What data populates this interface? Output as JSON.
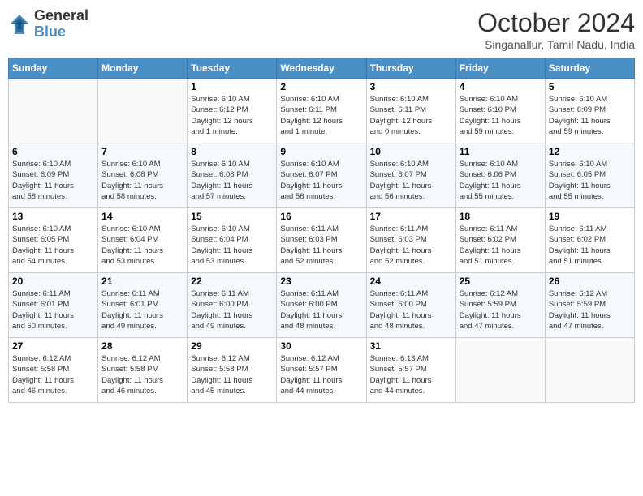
{
  "logo": {
    "line1": "General",
    "line2": "Blue"
  },
  "title": "October 2024",
  "location": "Singanallur, Tamil Nadu, India",
  "weekdays": [
    "Sunday",
    "Monday",
    "Tuesday",
    "Wednesday",
    "Thursday",
    "Friday",
    "Saturday"
  ],
  "weeks": [
    [
      {
        "day": "",
        "info": ""
      },
      {
        "day": "",
        "info": ""
      },
      {
        "day": "1",
        "info": "Sunrise: 6:10 AM\nSunset: 6:12 PM\nDaylight: 12 hours\nand 1 minute."
      },
      {
        "day": "2",
        "info": "Sunrise: 6:10 AM\nSunset: 6:11 PM\nDaylight: 12 hours\nand 1 minute."
      },
      {
        "day": "3",
        "info": "Sunrise: 6:10 AM\nSunset: 6:11 PM\nDaylight: 12 hours\nand 0 minutes."
      },
      {
        "day": "4",
        "info": "Sunrise: 6:10 AM\nSunset: 6:10 PM\nDaylight: 11 hours\nand 59 minutes."
      },
      {
        "day": "5",
        "info": "Sunrise: 6:10 AM\nSunset: 6:09 PM\nDaylight: 11 hours\nand 59 minutes."
      }
    ],
    [
      {
        "day": "6",
        "info": "Sunrise: 6:10 AM\nSunset: 6:09 PM\nDaylight: 11 hours\nand 58 minutes."
      },
      {
        "day": "7",
        "info": "Sunrise: 6:10 AM\nSunset: 6:08 PM\nDaylight: 11 hours\nand 58 minutes."
      },
      {
        "day": "8",
        "info": "Sunrise: 6:10 AM\nSunset: 6:08 PM\nDaylight: 11 hours\nand 57 minutes."
      },
      {
        "day": "9",
        "info": "Sunrise: 6:10 AM\nSunset: 6:07 PM\nDaylight: 11 hours\nand 56 minutes."
      },
      {
        "day": "10",
        "info": "Sunrise: 6:10 AM\nSunset: 6:07 PM\nDaylight: 11 hours\nand 56 minutes."
      },
      {
        "day": "11",
        "info": "Sunrise: 6:10 AM\nSunset: 6:06 PM\nDaylight: 11 hours\nand 55 minutes."
      },
      {
        "day": "12",
        "info": "Sunrise: 6:10 AM\nSunset: 6:05 PM\nDaylight: 11 hours\nand 55 minutes."
      }
    ],
    [
      {
        "day": "13",
        "info": "Sunrise: 6:10 AM\nSunset: 6:05 PM\nDaylight: 11 hours\nand 54 minutes."
      },
      {
        "day": "14",
        "info": "Sunrise: 6:10 AM\nSunset: 6:04 PM\nDaylight: 11 hours\nand 53 minutes."
      },
      {
        "day": "15",
        "info": "Sunrise: 6:10 AM\nSunset: 6:04 PM\nDaylight: 11 hours\nand 53 minutes."
      },
      {
        "day": "16",
        "info": "Sunrise: 6:11 AM\nSunset: 6:03 PM\nDaylight: 11 hours\nand 52 minutes."
      },
      {
        "day": "17",
        "info": "Sunrise: 6:11 AM\nSunset: 6:03 PM\nDaylight: 11 hours\nand 52 minutes."
      },
      {
        "day": "18",
        "info": "Sunrise: 6:11 AM\nSunset: 6:02 PM\nDaylight: 11 hours\nand 51 minutes."
      },
      {
        "day": "19",
        "info": "Sunrise: 6:11 AM\nSunset: 6:02 PM\nDaylight: 11 hours\nand 51 minutes."
      }
    ],
    [
      {
        "day": "20",
        "info": "Sunrise: 6:11 AM\nSunset: 6:01 PM\nDaylight: 11 hours\nand 50 minutes."
      },
      {
        "day": "21",
        "info": "Sunrise: 6:11 AM\nSunset: 6:01 PM\nDaylight: 11 hours\nand 49 minutes."
      },
      {
        "day": "22",
        "info": "Sunrise: 6:11 AM\nSunset: 6:00 PM\nDaylight: 11 hours\nand 49 minutes."
      },
      {
        "day": "23",
        "info": "Sunrise: 6:11 AM\nSunset: 6:00 PM\nDaylight: 11 hours\nand 48 minutes."
      },
      {
        "day": "24",
        "info": "Sunrise: 6:11 AM\nSunset: 6:00 PM\nDaylight: 11 hours\nand 48 minutes."
      },
      {
        "day": "25",
        "info": "Sunrise: 6:12 AM\nSunset: 5:59 PM\nDaylight: 11 hours\nand 47 minutes."
      },
      {
        "day": "26",
        "info": "Sunrise: 6:12 AM\nSunset: 5:59 PM\nDaylight: 11 hours\nand 47 minutes."
      }
    ],
    [
      {
        "day": "27",
        "info": "Sunrise: 6:12 AM\nSunset: 5:58 PM\nDaylight: 11 hours\nand 46 minutes."
      },
      {
        "day": "28",
        "info": "Sunrise: 6:12 AM\nSunset: 5:58 PM\nDaylight: 11 hours\nand 46 minutes."
      },
      {
        "day": "29",
        "info": "Sunrise: 6:12 AM\nSunset: 5:58 PM\nDaylight: 11 hours\nand 45 minutes."
      },
      {
        "day": "30",
        "info": "Sunrise: 6:12 AM\nSunset: 5:57 PM\nDaylight: 11 hours\nand 44 minutes."
      },
      {
        "day": "31",
        "info": "Sunrise: 6:13 AM\nSunset: 5:57 PM\nDaylight: 11 hours\nand 44 minutes."
      },
      {
        "day": "",
        "info": ""
      },
      {
        "day": "",
        "info": ""
      }
    ]
  ]
}
